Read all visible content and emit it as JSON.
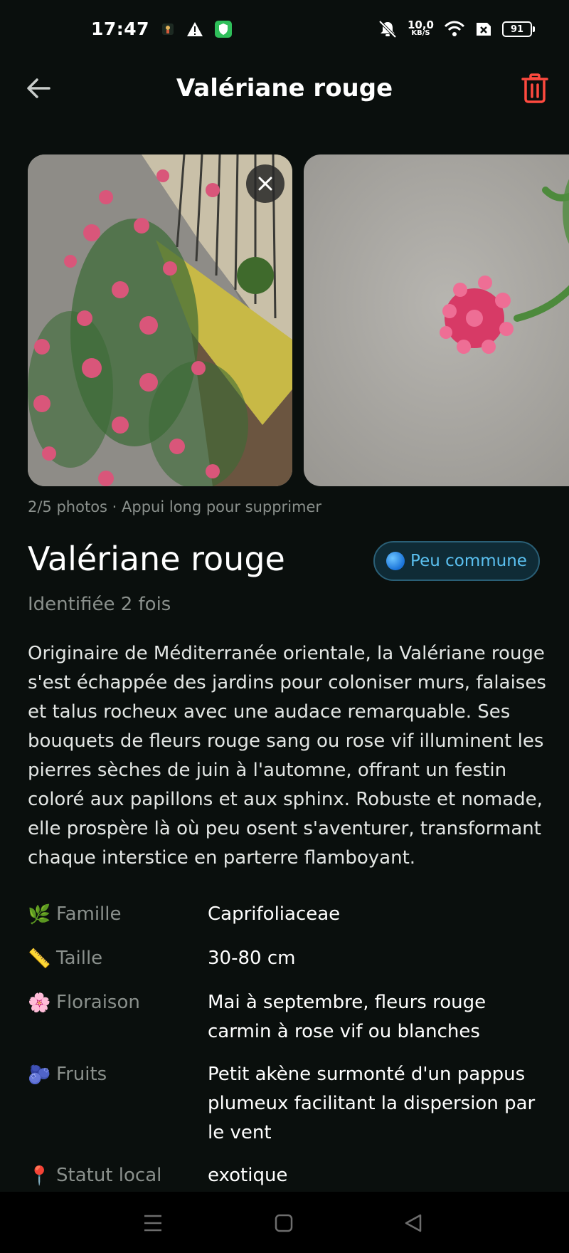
{
  "status_bar": {
    "time": "17:47",
    "net_speed_value": "10,0",
    "net_speed_unit": "KB/S",
    "battery": "91",
    "icons": [
      "app-notification-icon",
      "warning-icon",
      "shield-icon",
      "mute-icon",
      "wifi-icon",
      "sim-x-icon",
      "battery-icon"
    ]
  },
  "header": {
    "title": "Valériane rouge",
    "back_icon": "arrow-left-icon",
    "delete_icon": "trash-icon",
    "accent_delete": "#ff4a3f"
  },
  "gallery": {
    "hint": "2/5 photos · Appui long pour supprimer",
    "remove_icon": "close-icon"
  },
  "species": {
    "name": "Valériane rouge",
    "rarity": "Peu commune",
    "rarity_color": "#5bc0f0",
    "identified": "Identifiée 2 fois",
    "description": "Originaire de Méditerranée orientale, la Valériane rouge s'est échappée des jardins pour coloniser murs, falaises et talus rocheux avec une audace remarquable. Ses bouquets de fleurs rouge sang ou rose vif illuminent les pierres sèches de juin à l'automne, offrant un festin coloré aux papillons et aux sphinx. Robuste et nomade, elle prospère là où peu osent s'aventurer, transformant chaque interstice en parterre flamboyant."
  },
  "details": [
    {
      "emoji": "🌿",
      "label": "Famille",
      "value": "Caprifoliaceae"
    },
    {
      "emoji": "📏",
      "label": "Taille",
      "value": "30-80 cm"
    },
    {
      "emoji": "🌸",
      "label": "Floraison",
      "value": "Mai à septembre, fleurs rouge carmin à rose vif ou blanches"
    },
    {
      "emoji": "🫐",
      "label": "Fruits",
      "value": "Petit akène surmonté d'un pappus plumeux facilitant la dispersion par le vent"
    },
    {
      "emoji": "📍",
      "label": "Statut local",
      "value": "exotique"
    }
  ],
  "nav_bar": {
    "icons": [
      "menu-icon",
      "home-icon",
      "back-triangle-icon"
    ]
  }
}
